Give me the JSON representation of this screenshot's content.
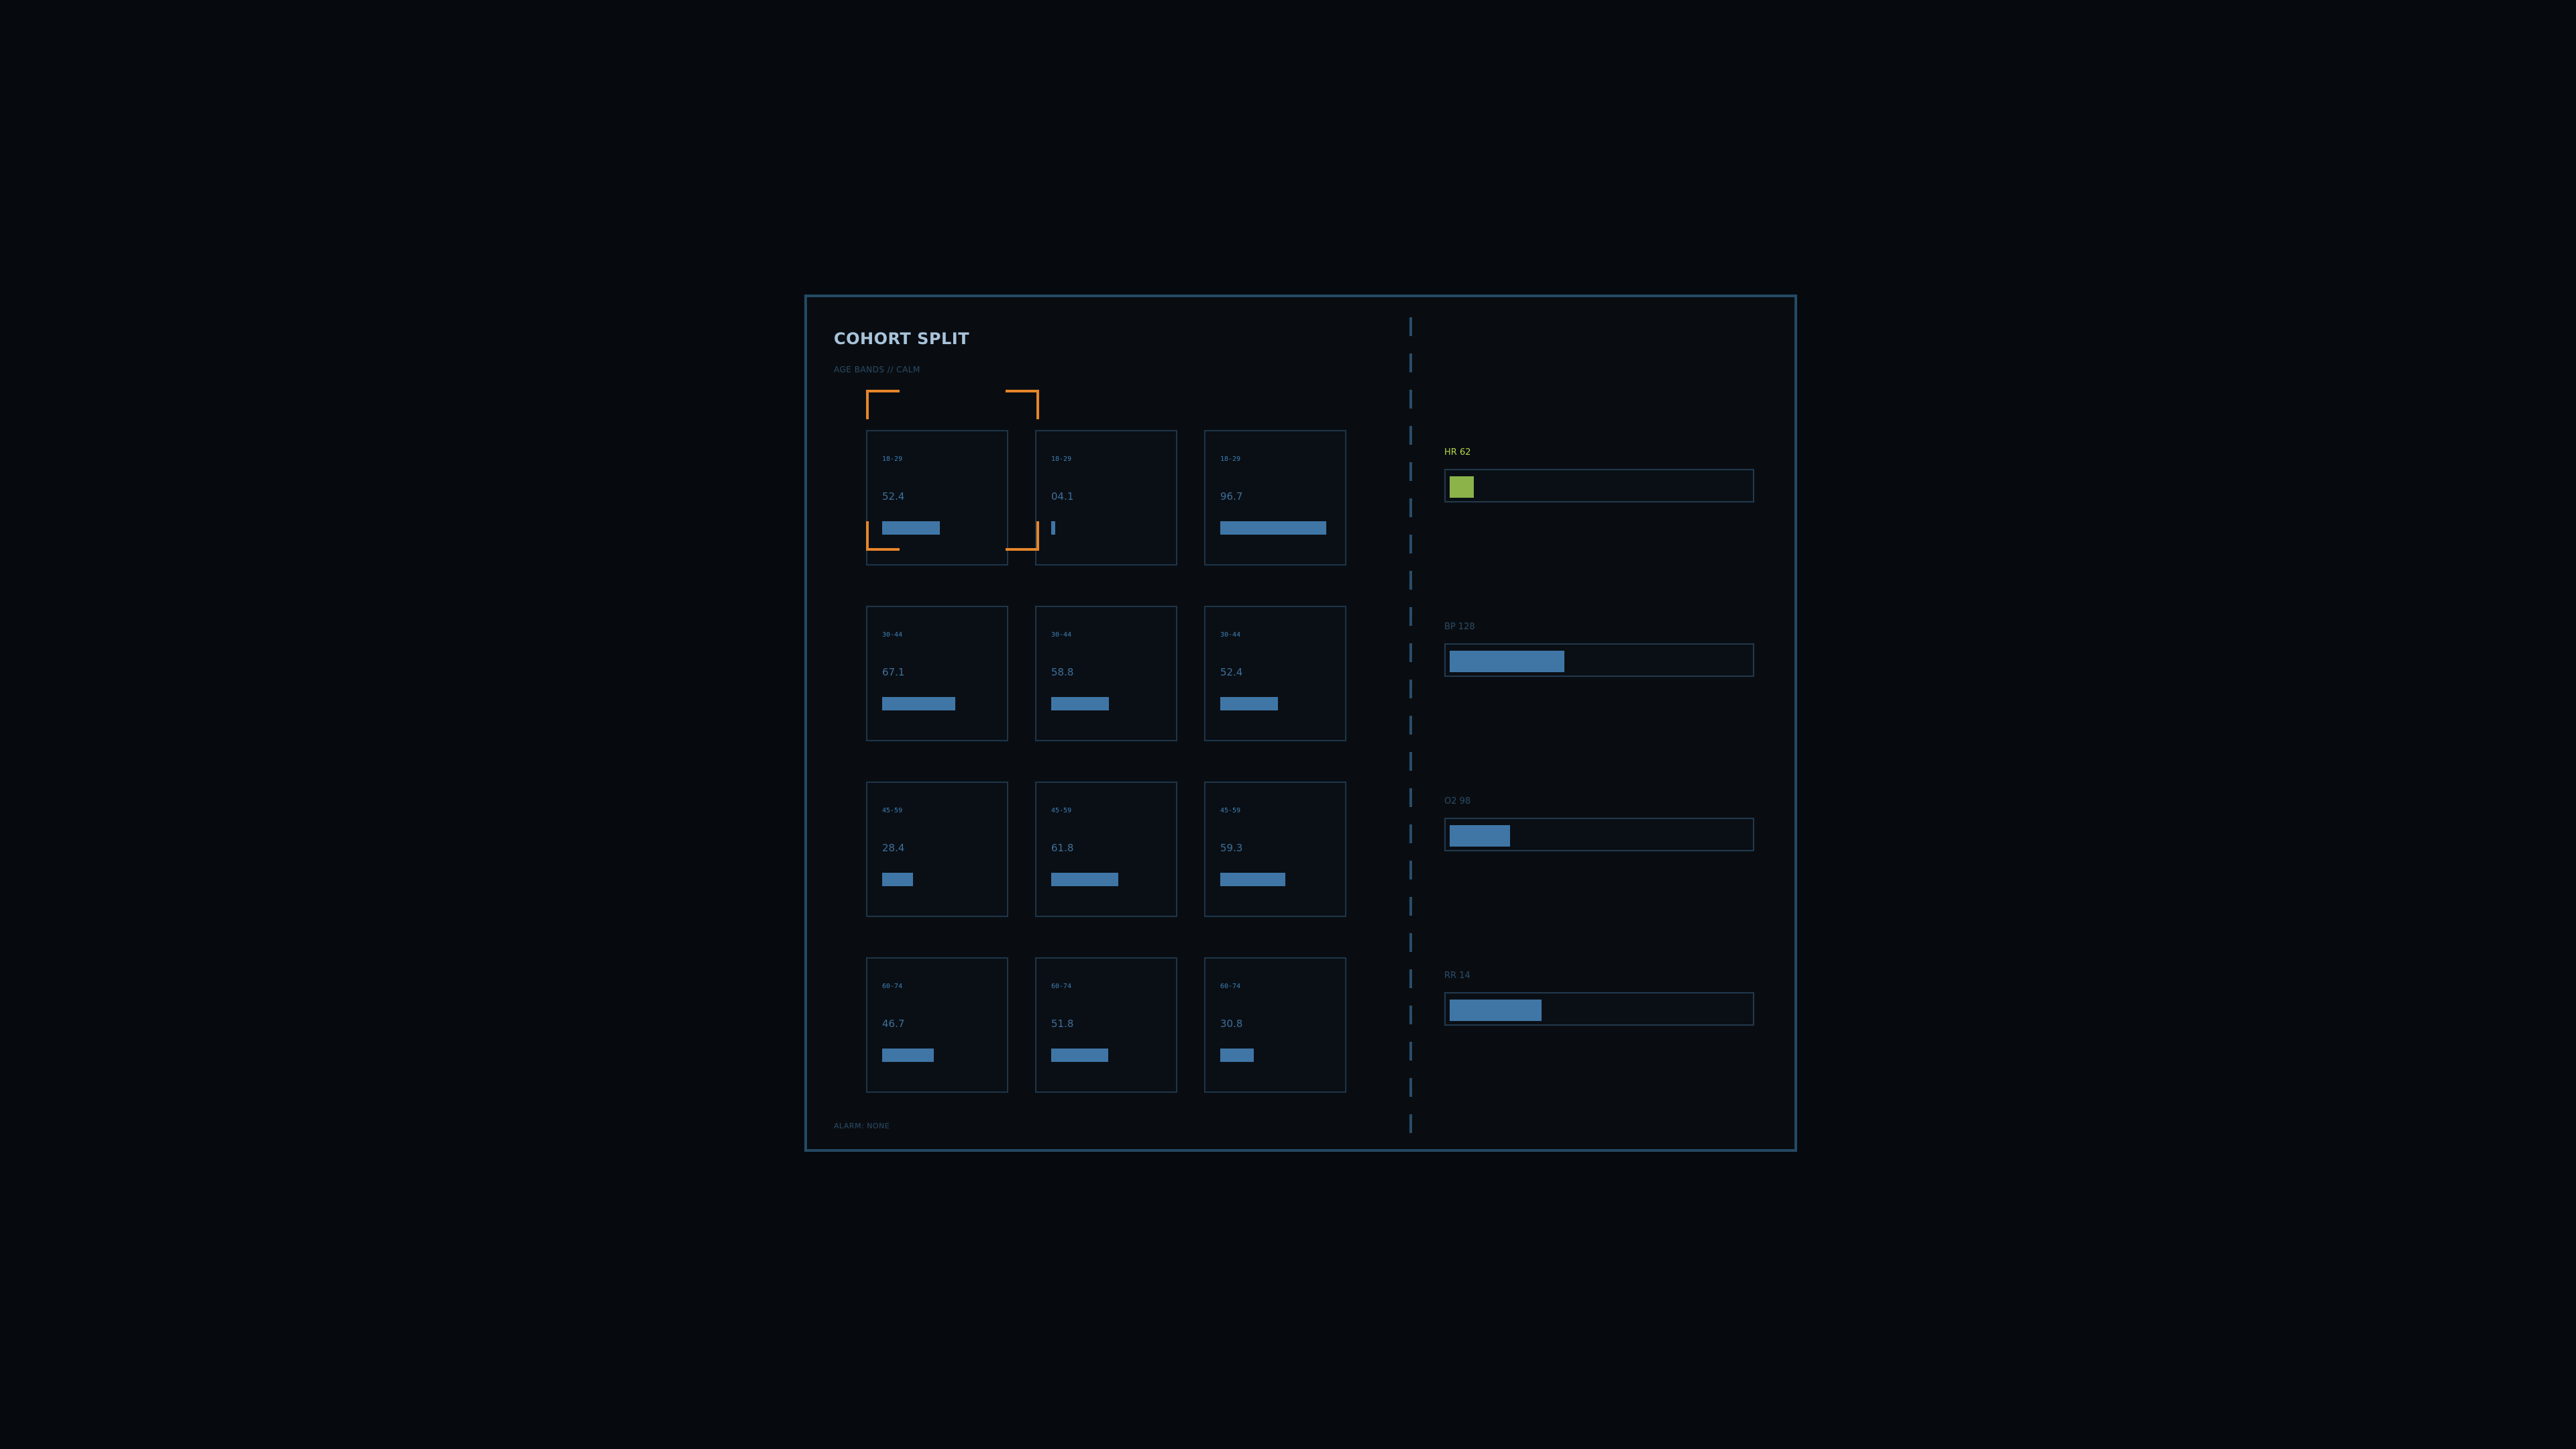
{
  "panel": {
    "title": "COHORT SPLIT",
    "subtitle": "AGE BANDS // CALM",
    "footer": "ALARM: NONE"
  },
  "cohort_rows": [
    {
      "label": "18-29",
      "cells": [
        {
          "label": "18-29",
          "value": "52.4",
          "fraction": 0.545
        },
        {
          "label": "18-29",
          "value": "04.1",
          "fraction": 0.03
        },
        {
          "label": "18-29",
          "value": "96.7",
          "fraction": 1.0
        }
      ]
    },
    {
      "label": "30-44",
      "cells": [
        {
          "label": "30-44",
          "value": "67.1",
          "fraction": 0.69
        },
        {
          "label": "30-44",
          "value": "58.8",
          "fraction": 0.545
        },
        {
          "label": "30-44",
          "value": "52.4",
          "fraction": 0.545
        }
      ]
    },
    {
      "label": "45-59",
      "cells": [
        {
          "label": "45-59",
          "value": "28.4",
          "fraction": 0.29
        },
        {
          "label": "45-59",
          "value": "61.8",
          "fraction": 0.635
        },
        {
          "label": "45-59",
          "value": "59.3",
          "fraction": 0.615
        }
      ]
    },
    {
      "label": "60-74",
      "cells": [
        {
          "label": "60-74",
          "value": "46.7",
          "fraction": 0.485
        },
        {
          "label": "60-74",
          "value": "51.8",
          "fraction": 0.535
        },
        {
          "label": "60-74",
          "value": "30.8",
          "fraction": 0.315
        }
      ]
    }
  ],
  "metrics": [
    {
      "label": "HR 62",
      "fraction": 0.08,
      "active": true
    },
    {
      "label": "BP 128",
      "fraction": 0.38,
      "active": false
    },
    {
      "label": "O2 98",
      "fraction": 0.2,
      "active": false
    },
    {
      "label": "RR 14",
      "fraction": 0.305,
      "active": false
    }
  ],
  "selection": {
    "row": 0,
    "col": 0
  },
  "colors": {
    "accent": "#e6852a",
    "bar": "#3f76a6",
    "active": "#8bb34a",
    "active_label": "#b4d34a",
    "border": "#244a64"
  }
}
